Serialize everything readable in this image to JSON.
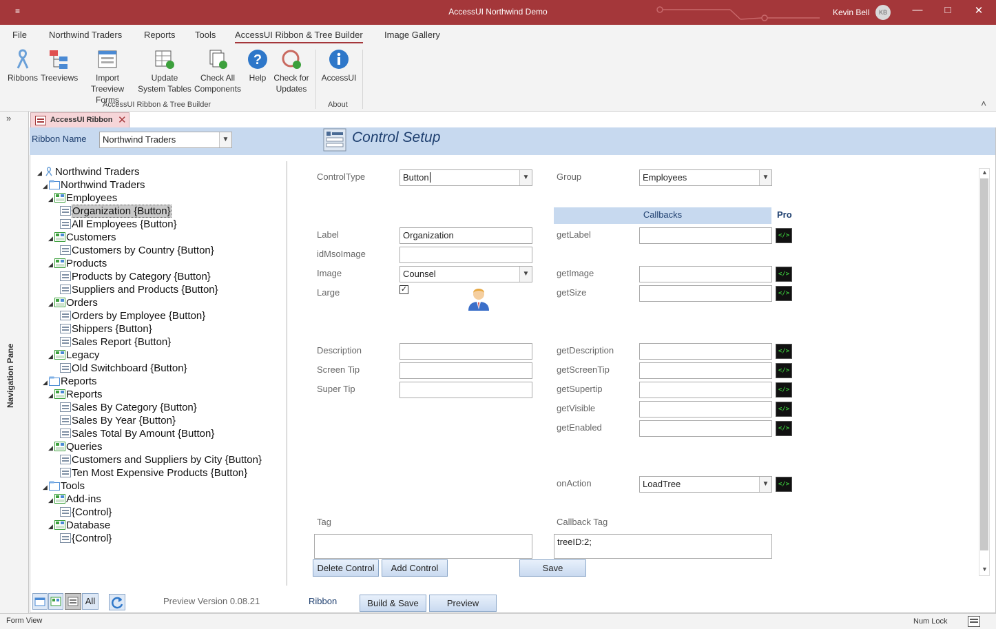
{
  "window": {
    "title": "AccessUI Northwind Demo",
    "quick_access": "≡",
    "user_name": "Kevin Bell",
    "user_initials": "KB",
    "minimize": "—",
    "maximize": "□",
    "close": "✕"
  },
  "menu": {
    "tabs": [
      "File",
      "Northwind Traders",
      "Reports",
      "Tools",
      "AccessUI Ribbon & Tree Builder",
      "Image Gallery"
    ]
  },
  "ribbon": {
    "buttons": [
      {
        "line1": "Ribbons",
        "line2": "",
        "icon": "ribbon-icon"
      },
      {
        "line1": "Treeviews",
        "line2": "",
        "icon": "treeview-icon"
      },
      {
        "line1": "Import",
        "line2": "Treeview Forms",
        "icon": "form-icon"
      },
      {
        "line1": "Update",
        "line2": "System Tables",
        "icon": "table-refresh-icon"
      },
      {
        "line1": "Check All",
        "line2": "Components",
        "icon": "check-components-icon"
      },
      {
        "line1": "Help",
        "line2": "",
        "icon": "help-icon"
      },
      {
        "line1": "Check for",
        "line2": "Updates",
        "icon": "update-check-icon"
      },
      {
        "line1": "AccessUI",
        "line2": "",
        "icon": "info-icon"
      }
    ],
    "group_builder": "AccessUI Ribbon & Tree Builder",
    "group_about": "About",
    "collapse_glyph": "˄"
  },
  "navpane": {
    "label": "Navigation Pane",
    "toggle": "»"
  },
  "form_tab": {
    "label": "AccessUI Ribbon",
    "close": "✕"
  },
  "header": {
    "ribbon_name_label": "Ribbon Name",
    "ribbon_name_value": "Northwind Traders",
    "title": "Control Setup"
  },
  "tree": [
    {
      "text": "Northwind Traders",
      "level": 0,
      "icon": "ribbon",
      "sel": false
    },
    {
      "text": "Northwind Traders",
      "level": 1,
      "icon": "tab",
      "sel": false
    },
    {
      "text": "Employees",
      "level": 2,
      "icon": "group",
      "sel": false
    },
    {
      "text": "Organization {Button}",
      "level": 3,
      "icon": "button",
      "sel": true
    },
    {
      "text": "All Employees {Button}",
      "level": 3,
      "icon": "button",
      "sel": false
    },
    {
      "text": "Customers",
      "level": 2,
      "icon": "group",
      "sel": false
    },
    {
      "text": "Customers by Country {Button}",
      "level": 3,
      "icon": "button",
      "sel": false
    },
    {
      "text": "Products",
      "level": 2,
      "icon": "group",
      "sel": false
    },
    {
      "text": "Products by Category {Button}",
      "level": 3,
      "icon": "button",
      "sel": false
    },
    {
      "text": "Suppliers and Products {Button}",
      "level": 3,
      "icon": "button",
      "sel": false
    },
    {
      "text": "Orders",
      "level": 2,
      "icon": "group",
      "sel": false
    },
    {
      "text": "Orders by Employee {Button}",
      "level": 3,
      "icon": "button",
      "sel": false
    },
    {
      "text": "Shippers {Button}",
      "level": 3,
      "icon": "button",
      "sel": false
    },
    {
      "text": "Sales Report {Button}",
      "level": 3,
      "icon": "button",
      "sel": false
    },
    {
      "text": "Legacy",
      "level": 2,
      "icon": "group",
      "sel": false
    },
    {
      "text": "Old Switchboard {Button}",
      "level": 3,
      "icon": "button",
      "sel": false
    },
    {
      "text": "Reports",
      "level": 1,
      "icon": "tab",
      "sel": false
    },
    {
      "text": "Reports",
      "level": 2,
      "icon": "group",
      "sel": false
    },
    {
      "text": "Sales By Category {Button}",
      "level": 3,
      "icon": "button",
      "sel": false
    },
    {
      "text": "Sales By Year {Button}",
      "level": 3,
      "icon": "button",
      "sel": false
    },
    {
      "text": "Sales Total By Amount {Button}",
      "level": 3,
      "icon": "button",
      "sel": false
    },
    {
      "text": "Queries",
      "level": 2,
      "icon": "group",
      "sel": false
    },
    {
      "text": "Customers and Suppliers by City {Button}",
      "level": 3,
      "icon": "button",
      "sel": false
    },
    {
      "text": "Ten Most Expensive Products {Button}",
      "level": 3,
      "icon": "button",
      "sel": false
    },
    {
      "text": "Tools",
      "level": 1,
      "icon": "tab",
      "sel": false
    },
    {
      "text": "Add-ins",
      "level": 2,
      "icon": "group",
      "sel": false
    },
    {
      "text": "{Control}",
      "level": 3,
      "icon": "button",
      "sel": false
    },
    {
      "text": "Database",
      "level": 2,
      "icon": "group",
      "sel": false
    },
    {
      "text": "{Control}",
      "level": 3,
      "icon": "button",
      "sel": false
    }
  ],
  "form": {
    "control_type_label": "ControlType",
    "control_type_value": "Button",
    "group_label": "Group",
    "group_value": "Employees",
    "callbacks_header": "Callbacks",
    "pro_label": "Pro",
    "label_label": "Label",
    "label_value": "Organization",
    "idmso_label": "idMsoImage",
    "idmso_value": "",
    "image_label": "Image",
    "image_value": "Counsel",
    "large_label": "Large",
    "large_checked": "✓",
    "description_label": "Description",
    "description_value": "",
    "screentip_label": "Screen Tip",
    "screentip_value": "",
    "supertip_label": "Super Tip",
    "supertip_value": "",
    "tag_label": "Tag",
    "tag_value": "",
    "callback_tag_label": "Callback Tag",
    "callback_tag_value": "treeID:2;",
    "get_label": "getLabel",
    "get_image": "getImage",
    "get_size": "getSize",
    "get_description": "getDescription",
    "get_screentip": "getScreenTip",
    "get_supertip": "getSupertip",
    "get_visible": "getVisible",
    "get_enabled": "getEnabled",
    "on_action_label": "onAction",
    "on_action_value": "LoadTree",
    "code_glyph": "</>"
  },
  "buttons": {
    "delete_control": "Delete Control",
    "add_control": "Add Control",
    "save": "Save",
    "build_save": "Build & Save",
    "preview": "Preview",
    "all": "All"
  },
  "footer": {
    "version": "Preview Version 0.08.21",
    "ribbon_label": "Ribbon"
  },
  "status": {
    "left": "Form View",
    "num_lock": "Num Lock"
  }
}
